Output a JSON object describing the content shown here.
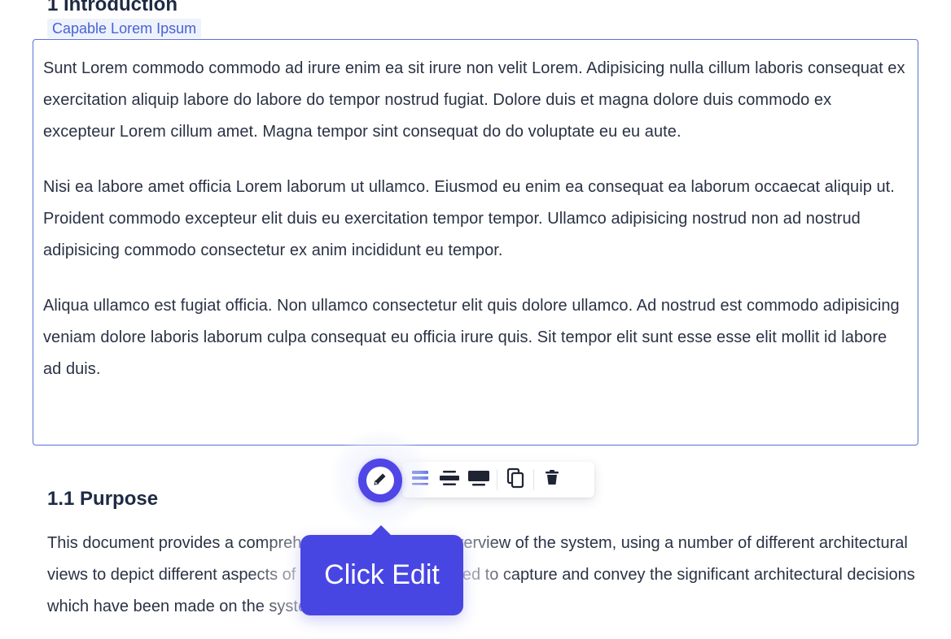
{
  "clipped_heading": "1 Introduction",
  "block": {
    "label": "Capable Lorem Ipsum",
    "paragraphs": [
      "Sunt Lorem commodo commodo ad irure enim ea sit irure non velit Lorem. Adipisicing nulla cillum laboris consequat ex exercitation aliquip labore do labore do tempor nostrud fugiat. Dolore duis et magna dolore duis commodo ex excepteur Lorem cillum amet. Magna tempor sint consequat do do voluptate eu eu aute.",
      "Nisi ea labore amet officia Lorem laborum ut ullamco. Eiusmod eu enim ea consequat ea laborum occaecat aliquip ut. Proident commodo excepteur elit duis eu exercitation tempor tempor. Ullamco adipisicing nostrud non ad nostrud adipisicing commodo consectetur ex anim incididunt eu tempor.",
      "Aliqua ullamco est fugiat officia. Non ullamco consectetur elit quis dolore ullamco. Ad nostrud est commodo adipisicing veniam dolore laboris laborum culpa consequat eu officia irure quis. Sit tempor elit sunt esse esse elit mollit id labore ad duis."
    ]
  },
  "toolbar": {
    "buttons": [
      "pencil-icon",
      "align-left-width-icon",
      "align-center-width-icon",
      "full-width-icon",
      "copy-icon",
      "trash-icon"
    ],
    "accent": "#4f46e5",
    "active": "#5b6ee1",
    "dark": "#1f2433"
  },
  "section": {
    "heading": "1.1 Purpose",
    "body": "This document provides a comprehensive architectural overview of the system, using a number of different architectural views to depict different aspects of the system. It is intended to capture and convey the significant architectural decisions which have been made on the system."
  },
  "tooltip": {
    "text": "Click Edit",
    "color": "#4846e3"
  }
}
